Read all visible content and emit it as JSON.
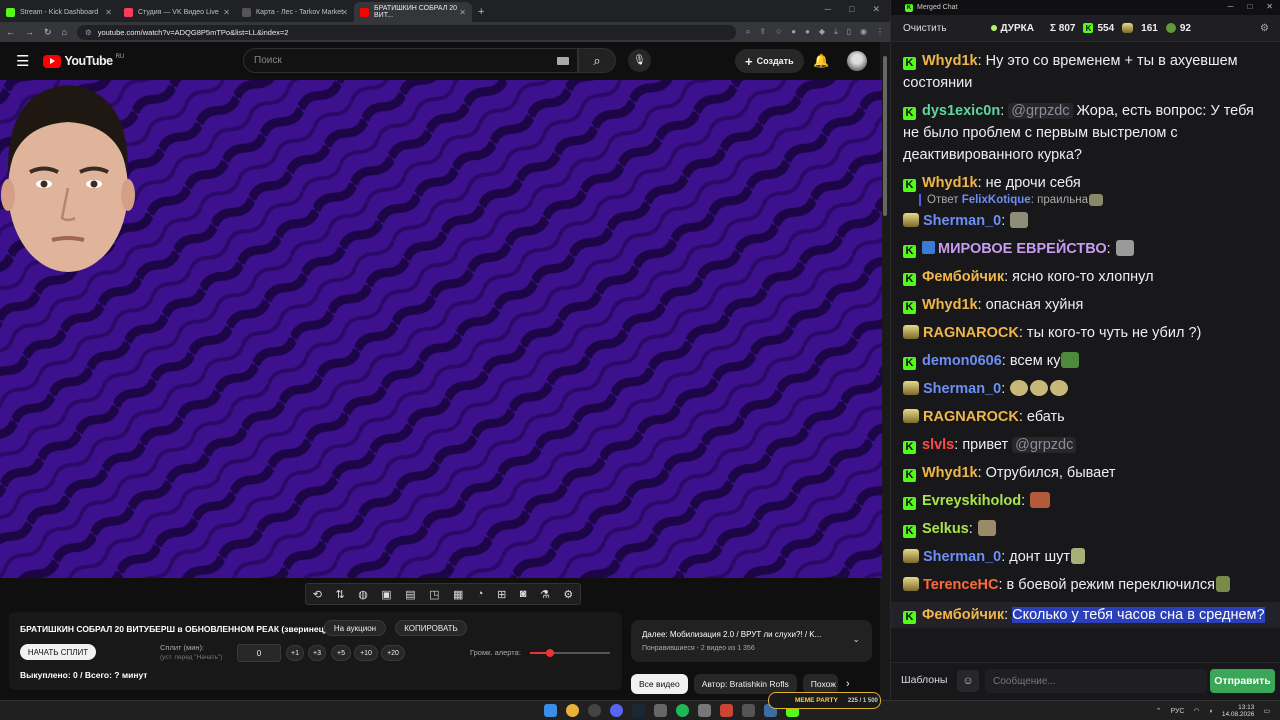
{
  "browser": {
    "tabs": [
      {
        "label": "Stream - Kick Dashboard",
        "color": "#53fc18"
      },
      {
        "label": "Студия — VK Видео Live",
        "color": "#ff3b5c"
      },
      {
        "label": "Карта - Лес - Tarkov Market",
        "color": "#2a2a2a"
      },
      {
        "label": "БРАТИШКИН СОБРАЛ 20 ВИТ...",
        "color": "#ff0000"
      }
    ],
    "url": "youtube.com/watch?v=ADQG8P5mTPo&list=LL&index=2"
  },
  "youtube": {
    "logo_text": "YouTube",
    "region": "RU",
    "search_placeholder": "Поиск",
    "create_label": "Создать"
  },
  "panel": {
    "video_title": "БРАТИШКИН СОБРАЛ 20 ВИТУБЕРШ в ОБНОВЛЕННОМ РЕАК (зверинец)",
    "auction_label": "На аукцион",
    "copy_label": "КОПИРОВАТЬ",
    "start_split_label": "НАЧАТЬ СПЛИТ",
    "split_label": "Сплит (мин):",
    "split_hint": "(уст. перед \"Начать\")",
    "split_value": "0",
    "increments": [
      "+1",
      "+3",
      "+5",
      "+10",
      "+20"
    ],
    "alert_volume_label": "Громк. алерта:",
    "alert_volume_fraction": 0.25,
    "bought_text": "Выкуплено: 0 / Всего: ? минут"
  },
  "next": {
    "title": "Далее: Мобилизация 2.0 / ВРУТ ли слухи?! / K...",
    "subtitle": "Понравившиеся - 2 видео из 1 356"
  },
  "chips": [
    "Все видео",
    "Автор: Bratishkin Rofls",
    "Похож"
  ],
  "chat": {
    "window_title": "Merged Chat",
    "clear_label": "Очистить",
    "channel": "ДУРКА",
    "total": "Σ 807",
    "kick_count": "554",
    "vk_count": "161",
    "twitch_count": "92",
    "templates_label": "Шаблоны",
    "input_placeholder": "Сообщение...",
    "send_label": "Отправить",
    "messages": [
      {
        "src": "kick",
        "name": "Whyd1k",
        "color": "#f0b64a",
        "text": "Ну это со временем + ты в ахуевшем состоянии"
      },
      {
        "src": "kick",
        "name": "dys1exic0n",
        "color": "#5fd6a0",
        "mention": "@grpzdc",
        "text": "Жора, есть вопрос: У тебя не было проблем с первым выстрелом с деактивированного курка?"
      },
      {
        "src": "kick",
        "name": "Whyd1k",
        "color": "#f0b64a",
        "text": "не дрочи себя",
        "reply": {
          "prefix": "Ответ",
          "name": "FelixKotique",
          "text": "праильна"
        }
      },
      {
        "src": "vk",
        "name": "Sherman_0",
        "color": "#6d8ef5",
        "text": ""
      },
      {
        "src": "kick",
        "name": "МИРОВОЕ ЕВРЕЙСТВО",
        "color": "#c89bf2",
        "text": ""
      },
      {
        "src": "kick",
        "name": "Фембойчик",
        "color": "#f0b64a",
        "text": "ясно кого-то хлопнул"
      },
      {
        "src": "kick",
        "name": "Whyd1k",
        "color": "#f0b64a",
        "text": "опасная хуйня"
      },
      {
        "src": "vk",
        "name": "RAGNAROCK",
        "color": "#f0b64a",
        "text": "ты кого-то чуть не убил ?)"
      },
      {
        "src": "kick",
        "name": "demon0606",
        "color": "#6d8ef5",
        "text": "всем ку"
      },
      {
        "src": "vk",
        "name": "Sherman_0",
        "color": "#6d8ef5",
        "text": ""
      },
      {
        "src": "vk",
        "name": "RAGNAROCK",
        "color": "#f0b64a",
        "text": "ебать"
      },
      {
        "src": "kick",
        "name": "slvls",
        "color": "#ff4a4a",
        "text": "привет",
        "mention": "@grpzdc"
      },
      {
        "src": "kick",
        "name": "Whyd1k",
        "color": "#f0b64a",
        "text": "Отрубился, бывает"
      },
      {
        "src": "kick",
        "name": "Evreyskiholod",
        "color": "#a8e44a",
        "text": ""
      },
      {
        "src": "kick",
        "name": "Selkus",
        "color": "#a8e44a",
        "text": ""
      },
      {
        "src": "vk",
        "name": "Sherman_0",
        "color": "#6d8ef5",
        "text": "донт шут"
      },
      {
        "src": "vk",
        "name": "TerenceHC",
        "color": "#ff6a3d",
        "text": "в боевой режим переключился"
      },
      {
        "src": "kick",
        "name": "Фембойчик",
        "color": "#f0b64a",
        "text": "Сколько у тебя часов сна в среднем?",
        "highlight": true
      }
    ]
  },
  "taskbar": {
    "lang": "РУС",
    "time": "13:13",
    "date": "14.08.2026",
    "meme_label": "MEME PARTY",
    "meme_count": "225 / 1 500"
  },
  "colors": {
    "kick": "#53fc18",
    "send": "#3aa657",
    "video_bg": "#3c0f8a",
    "chat_highlight": "#2b3fb8"
  }
}
